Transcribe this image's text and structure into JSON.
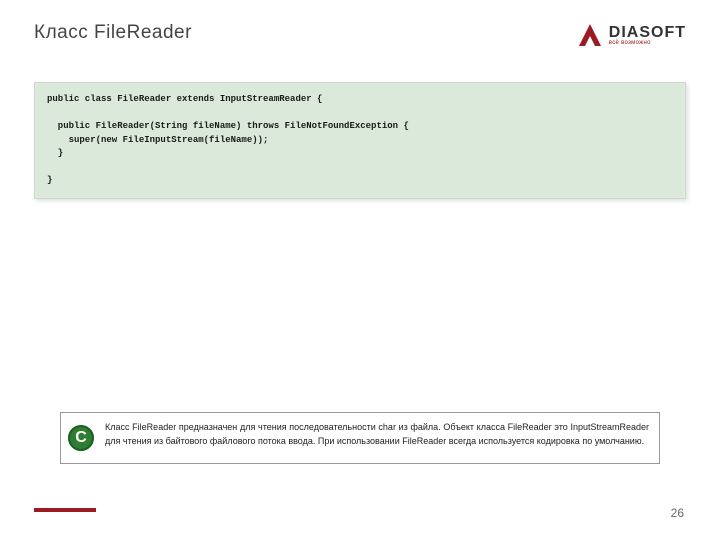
{
  "header": {
    "title": "Класс FileReader",
    "logo": {
      "name": "DIASOFT",
      "tagline": "всё возможно"
    }
  },
  "code": "public class FileReader extends InputStreamReader {\n\n  public FileReader(String fileName) throws FileNotFoundException {\n    super(new FileInputStream(fileName));\n  }\n\n}",
  "note": {
    "badge": "C",
    "text": "Класс FileReader предназначен для чтения последовательности char из файла. Объект класса FileReader это InputStreamReader для чтения из байтового файлового потока ввода. При использовании FileReader всегда используется кодировка по умолчанию."
  },
  "page_number": "26"
}
